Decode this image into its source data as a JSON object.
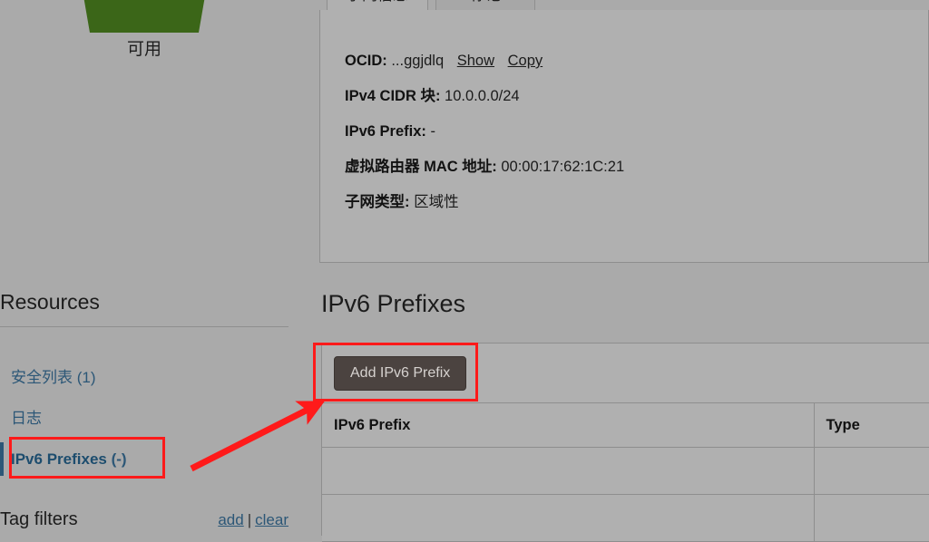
{
  "status": {
    "label": "可用",
    "icon": "shield-check-icon",
    "color": "#3b6618"
  },
  "tabs": [
    {
      "label": "子网信息",
      "active": true
    },
    {
      "label": "标记",
      "active": false
    }
  ],
  "subnet_info": [
    {
      "key": "OCID:",
      "value": "...ggjdlq",
      "actions": [
        "Show",
        "Copy"
      ]
    },
    {
      "key": "IPv4 CIDR 块:",
      "value": "10.0.0.0/24",
      "actions": []
    },
    {
      "key": "IPv6 Prefix:",
      "value": "-",
      "actions": []
    },
    {
      "key": "虚拟路由器 MAC 地址:",
      "value": "00:00:17:62:1C:21",
      "actions": []
    },
    {
      "key": "子网类型:",
      "value": "区域性",
      "actions": []
    }
  ],
  "sidebar": {
    "title": "Resources",
    "items": [
      {
        "label": "安全列表",
        "count": "(1)",
        "selected": false
      },
      {
        "label": "日志",
        "count": "",
        "selected": false
      },
      {
        "label": "IPv6 Prefixes",
        "count": "(-)",
        "selected": true
      }
    ],
    "tag_filters": {
      "title": "Tag filters",
      "add_label": "add",
      "separator": "|",
      "clear_label": "clear"
    }
  },
  "prefixes_section": {
    "title": "IPv6 Prefixes",
    "add_button_label": "Add IPv6 Prefix",
    "table": {
      "headers": [
        "IPv6 Prefix",
        "Type"
      ],
      "rows": [
        [
          "",
          ""
        ],
        [
          "",
          ""
        ]
      ]
    }
  },
  "annotations": {
    "highlight_color": "#ff1a1a",
    "boxes": [
      "sidebar-ipv6-prefixes-link",
      "add-ipv6-prefix-button"
    ],
    "arrow": "points-from-sidebar-link-to-add-button"
  }
}
